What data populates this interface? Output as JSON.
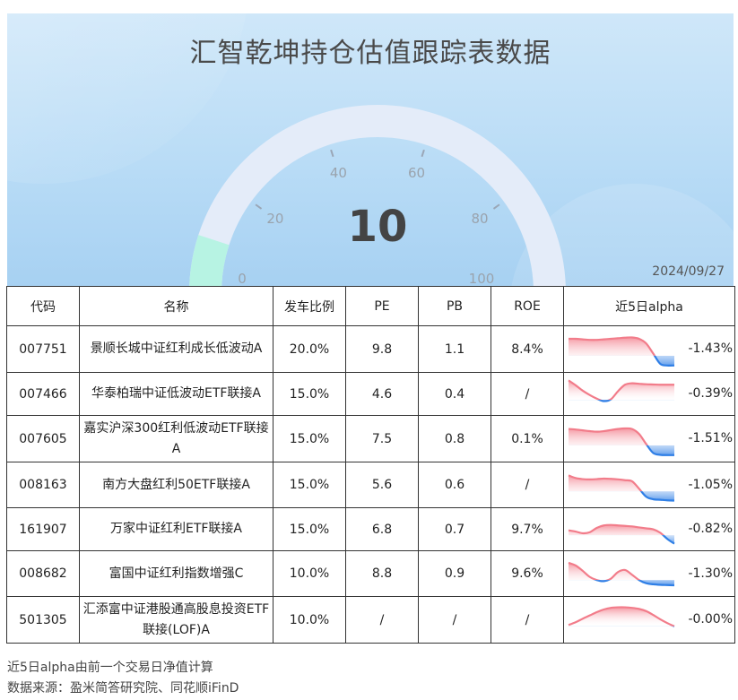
{
  "title": "汇智乾坤持仓估值跟踪表数据",
  "gauge": {
    "value": "10",
    "ticks": [
      "0",
      "20",
      "40",
      "60",
      "80",
      "100"
    ]
  },
  "date": "2024/09/27",
  "columns": [
    "代码",
    "名称",
    "发车比例",
    "PE",
    "PB",
    "ROE",
    "近5日alpha"
  ],
  "rows": [
    {
      "code": "007751",
      "name": "景顺长城中证红利成长低波动A",
      "ratio": "20.0%",
      "pe": "9.8",
      "pb": "1.1",
      "roe": "8.4%",
      "alpha": "-1.43%",
      "trend": [
        0.62,
        0.62,
        0.6,
        0.58,
        0.58,
        0.6,
        0.62,
        0.64,
        0.66,
        0.67,
        0.62,
        0.45,
        0.08,
        -0.3,
        -0.36,
        -0.36
      ]
    },
    {
      "code": "007466",
      "name": "华泰柏瑞中证低波动ETF联接A",
      "ratio": "15.0%",
      "pe": "4.6",
      "pb": "0.4",
      "roe": "/",
      "alpha": "-0.39%",
      "trend": [
        0.8,
        0.6,
        0.38,
        0.2,
        0.05,
        -0.05,
        0.02,
        0.35,
        0.62,
        0.68,
        0.66,
        0.64,
        0.63,
        0.62,
        0.62,
        0.62
      ]
    },
    {
      "code": "007605",
      "name": "嘉实沪深300红利低波动ETF联接A",
      "ratio": "15.0%",
      "pe": "7.5",
      "pb": "0.8",
      "roe": "0.1%",
      "alpha": "-1.51%",
      "trend": [
        0.6,
        0.58,
        0.55,
        0.52,
        0.5,
        0.52,
        0.56,
        0.6,
        0.62,
        0.6,
        0.42,
        0.05,
        -0.28,
        -0.35,
        -0.36,
        -0.36
      ]
    },
    {
      "code": "008163",
      "name": "南方大盘红利50ETF联接A",
      "ratio": "15.0%",
      "pe": "5.6",
      "pb": "0.6",
      "roe": "/",
      "alpha": "-1.05%",
      "trend": [
        0.6,
        0.5,
        0.46,
        0.45,
        0.46,
        0.48,
        0.47,
        0.45,
        0.42,
        0.38,
        0.1,
        -0.2,
        -0.3,
        -0.32,
        -0.34,
        -0.35
      ]
    },
    {
      "code": "161907",
      "name": "万家中证红利ETF联接A",
      "ratio": "15.0%",
      "pe": "6.8",
      "pb": "0.7",
      "roe": "9.7%",
      "alpha": "-0.82%",
      "trend": [
        0.2,
        0.15,
        0.08,
        0.12,
        0.3,
        0.4,
        0.42,
        0.4,
        0.38,
        0.36,
        0.32,
        0.28,
        0.24,
        0.1,
        -0.15,
        -0.35
      ]
    },
    {
      "code": "008682",
      "name": "富国中证红利指数增强C",
      "ratio": "10.0%",
      "pe": "8.8",
      "pb": "0.9",
      "roe": "9.6%",
      "alpha": "-1.30%",
      "trend": [
        0.65,
        0.55,
        0.35,
        0.12,
        0.0,
        -0.04,
        0.05,
        0.3,
        0.38,
        0.2,
        0.0,
        -0.12,
        -0.16,
        -0.18,
        -0.19,
        -0.2
      ]
    },
    {
      "code": "501305",
      "name": "汇添富中证港股通高股息投资ETF联接(LOF)A",
      "ratio": "10.0%",
      "pe": "/",
      "pb": "/",
      "roe": "/",
      "alpha": "-0.00%",
      "trend": [
        0.05,
        0.15,
        0.28,
        0.4,
        0.52,
        0.62,
        0.68,
        0.7,
        0.7,
        0.68,
        0.64,
        0.56,
        0.42,
        0.26,
        0.12,
        0.0
      ]
    }
  ],
  "notes": [
    "近5日alpha由前一个交易日净值计算",
    "数据来源：盈米简答研究院、同花顺iFinD"
  ],
  "colors": {
    "negative": "#2f7fe6",
    "positive": "#f27c8a",
    "gauge_fill": "#b7f3e3",
    "gauge_track": "#e4ecf9"
  }
}
